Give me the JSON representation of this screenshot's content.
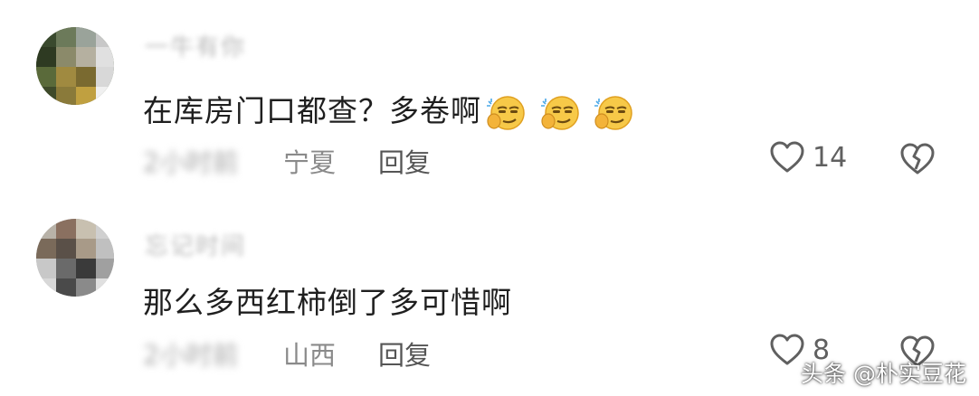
{
  "comments": [
    {
      "name": "一牛有你",
      "text": "在库房门口都查？多卷啊",
      "emojis": [
        "smirk-face-icon",
        "smirk-face-icon",
        "smirk-face-icon"
      ],
      "time": "2小时前",
      "location": "宁夏",
      "reply_label": "回复",
      "likes": "14"
    },
    {
      "name": "忘记时间",
      "text": "那么多西红柿倒了多可惜啊",
      "time": "2小时前",
      "location": "山西",
      "reply_label": "回复",
      "likes": "8"
    }
  ],
  "watermark": "头条 @朴实豆花",
  "colors": {
    "text": "#1f1f1f",
    "meta": "#8a8a8a",
    "reply": "#555555",
    "icon": "#606060"
  }
}
